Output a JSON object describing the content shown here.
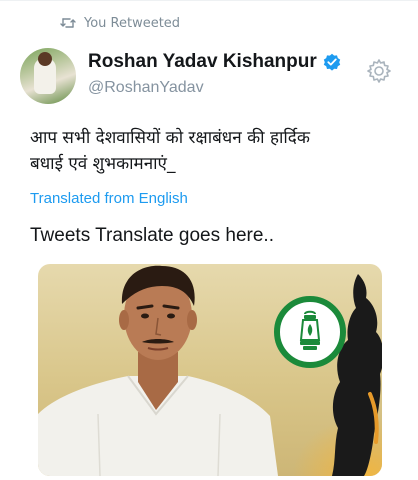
{
  "retweet": {
    "label": "You Retweeted",
    "icon": "retweet-icon"
  },
  "author": {
    "display_name": "Roshan Yadav Kishanpur",
    "handle": "@RoshanYadav",
    "verified_icon": "verified-badge-icon",
    "avatar_icon": "avatar"
  },
  "settings": {
    "icon": "gear-icon"
  },
  "tweet": {
    "text_line1": "आप सभी देशवासियों को रक्षाबंधन की हार्दिक",
    "text_line2": "बधाई एवं शुभकामनाएं_",
    "translated_label": "Translated from English",
    "translation_text": "Tweets Translate goes here.."
  },
  "colors": {
    "link": "#1d9bf0",
    "muted": "#8593a0",
    "verified": "#1d9bf0",
    "emblem_green": "#1b8a3a"
  }
}
